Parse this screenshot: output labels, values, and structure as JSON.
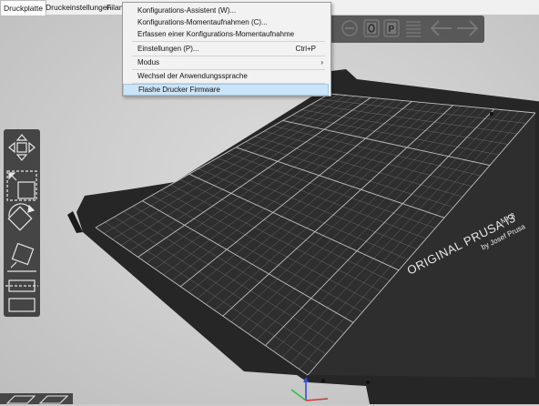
{
  "tabs": [
    {
      "label": "Druckplatte",
      "active": true
    },
    {
      "label": "Druckeinstellungen",
      "active": false
    },
    {
      "label": "Filam",
      "active": false
    }
  ],
  "menu": {
    "items": [
      {
        "label": "Konfigurations-Assistent (W)..."
      },
      {
        "label": "Konfigurations-Momentaufnahmen (C)..."
      },
      {
        "label": "Erfassen einer Konfigurations-Momentaufnahme"
      },
      {
        "label": "Einstellungen (P)...",
        "shortcut": "Ctrl+P"
      },
      {
        "label": "Modus",
        "submenu_arrow": "›"
      },
      {
        "label": "Wechsel der Anwendungssprache"
      },
      {
        "label": "Flashe Drucker Firmware",
        "highlighted": true
      }
    ]
  },
  "bed": {
    "brand_text": "ORIGINAL PRUSA i3",
    "model_text": "MK3",
    "byline_text": "by Josef Prusa"
  },
  "colors": {
    "bed_dark": "#2a2a2a",
    "grid_line": "#8a8a8a",
    "menu_highlight": "#cce4f7",
    "axis_x": "#e03030",
    "axis_y": "#30c040",
    "axis_z": "#3050e0"
  },
  "icons": {
    "left_toolbar": [
      "move-icon",
      "scale-icon",
      "rotate-icon",
      "place-on-face-icon",
      "cut-icon",
      "support-paint-icon"
    ],
    "top_toolbar": [
      "remove-icon",
      "zero-icon",
      "p-icon",
      "layers-icon",
      "undo-icon",
      "redo-icon"
    ]
  }
}
